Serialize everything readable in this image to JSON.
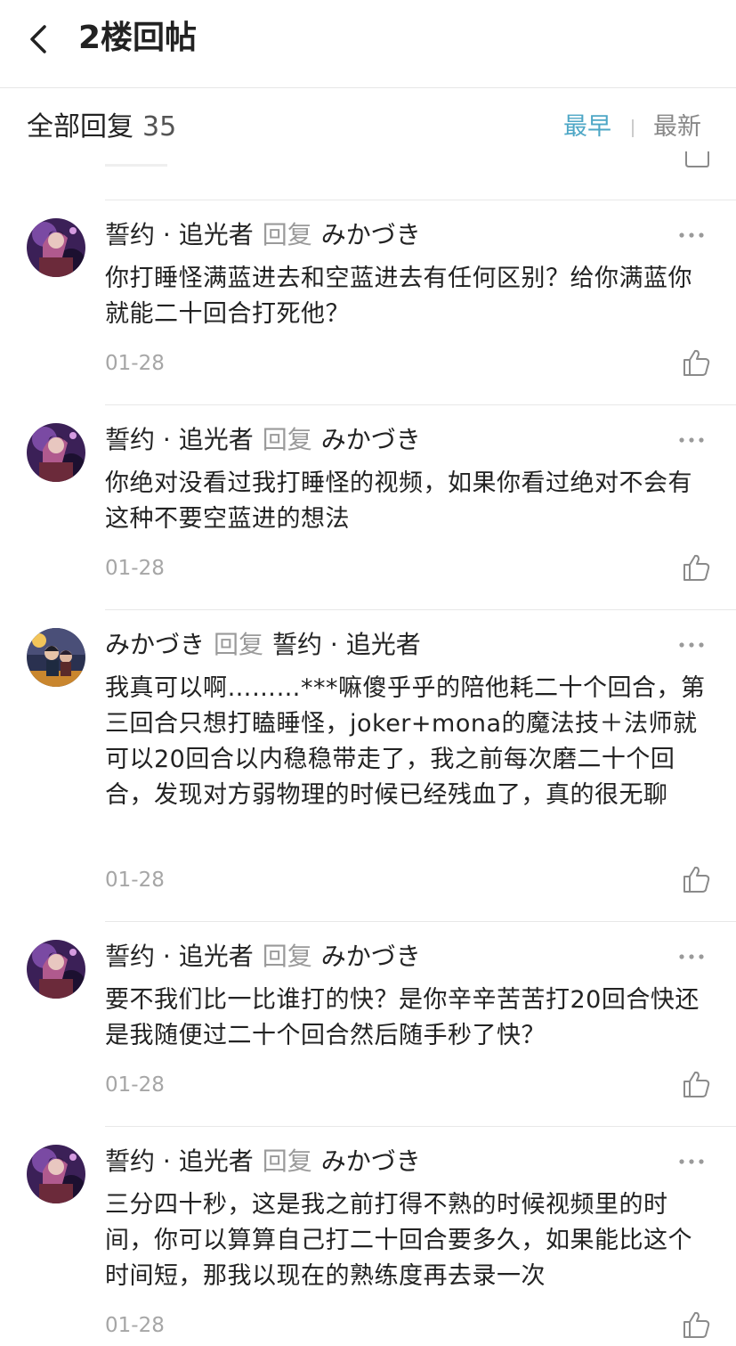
{
  "nav": {
    "title": "2楼回帖",
    "back_icon": "chevron-left-icon"
  },
  "filter": {
    "all_label": "全部回复",
    "count": "35",
    "sort_earliest": "最早",
    "sort_latest": "最新",
    "active_color": "#4ea7c6"
  },
  "replies": [
    {
      "author": "誓约 · 追光者",
      "reply_word": "回复",
      "target": "みかづき",
      "content": "你打睡怪满蓝进去和空蓝进去有任何区别？给你满蓝你就能二十回合打死他？",
      "date": "01-28",
      "avatar": "purple-character-avatar"
    },
    {
      "author": "誓约 · 追光者",
      "reply_word": "回复",
      "target": "みかづき",
      "content": "你绝对没看过我打睡怪的视频，如果你看过绝对不会有这种不要空蓝进的想法",
      "date": "01-28",
      "avatar": "purple-character-avatar"
    },
    {
      "author": "みかづき",
      "reply_word": "回复",
      "target": "誓约 · 追光者",
      "content": "我真可以啊………***嘛傻乎乎的陪他耗二十个回合，第三回合只想打瞌睡怪，joker+mona的魔法技＋法师就可以20回合以内稳稳带走了，我之前每次磨二十个回合，发现对方弱物理的时候已经残血了，真的很无聊",
      "date": "01-28",
      "avatar": "golden-scene-avatar"
    },
    {
      "author": "誓约 · 追光者",
      "reply_word": "回复",
      "target": "みかづき",
      "content": "要不我们比一比谁打的快？是你辛辛苦苦打20回合快还是我随便过二十个回合然后随手秒了快？",
      "date": "01-28",
      "avatar": "purple-character-avatar"
    },
    {
      "author": "誓约 · 追光者",
      "reply_word": "回复",
      "target": "みかづき",
      "content": "三分四十秒，这是我之前打得不熟的时候视频里的时间，你可以算算自己打二十回合要多久，如果能比这个时间短，那我以现在的熟练度再去录一次",
      "date": "01-28",
      "avatar": "purple-character-avatar"
    }
  ]
}
